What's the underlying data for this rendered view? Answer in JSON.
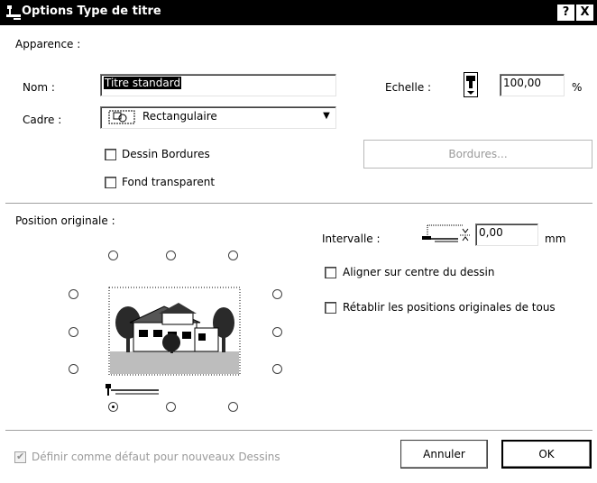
{
  "window": {
    "title": "Options Type de titre",
    "help_label": "?",
    "close_label": "X"
  },
  "appearance": {
    "section_label": "Apparence :",
    "name_label": "Nom :",
    "name_value": "Titre standard",
    "scale_label": "Echelle :",
    "scale_value": "100,00",
    "scale_unit": "%",
    "frame_label": "Cadre :",
    "frame_value": "Rectangulaire",
    "draw_borders_label": "Dessin Bordures",
    "draw_borders_checked": false,
    "transparent_bg_label": "Fond transparent",
    "transparent_bg_checked": false,
    "borders_button_label": "Bordures..."
  },
  "position": {
    "section_label": "Position originale :",
    "interval_label": "Intervalle :",
    "interval_value": "0,00",
    "interval_unit": "mm",
    "align_center_label": "Aligner sur centre du dessin",
    "align_center_checked": false,
    "restore_positions_label": "Rétablir les positions originales de tous",
    "restore_positions_checked": false,
    "selected_anchor": "bottom-left"
  },
  "footer": {
    "default_label": "Définir comme défaut pour nouveaux Dessins",
    "default_checked": true,
    "cancel_label": "Annuler",
    "ok_label": "OK"
  },
  "colors": {
    "titlebar": "#000000",
    "background": "#ffffff",
    "disabled_text": "#9a9a9a"
  }
}
